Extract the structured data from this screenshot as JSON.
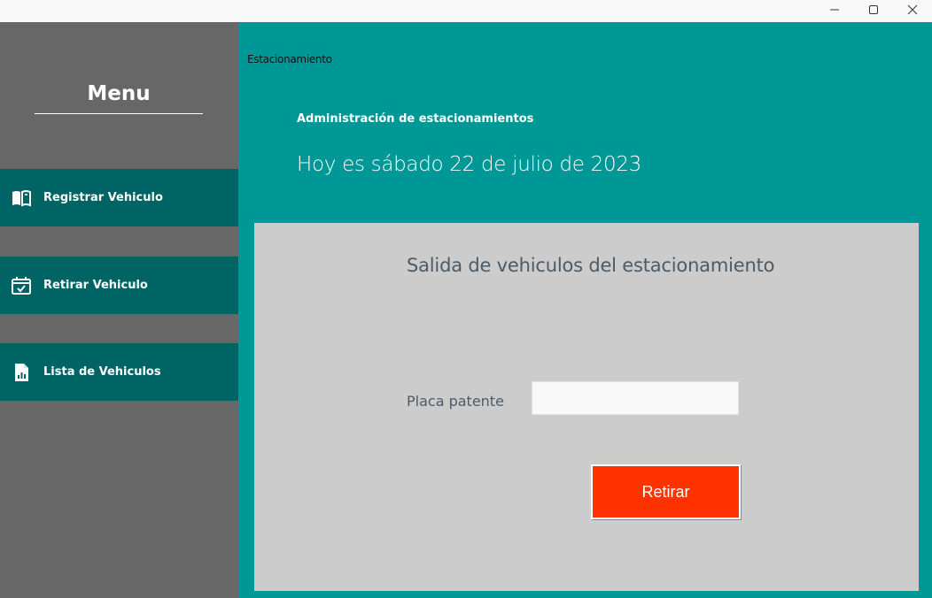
{
  "window": {
    "buttons": {
      "minimize": "minimize-icon",
      "maximize": "maximize-icon",
      "close": "close-icon"
    }
  },
  "sidebar": {
    "title": "Menu",
    "items": [
      {
        "label": "Registrar Vehiculo",
        "icon": "book-icon"
      },
      {
        "label": "Retirar Vehiculo",
        "icon": "calendar-check-icon"
      },
      {
        "label": "Lista de Vehiculos",
        "icon": "report-document-icon"
      }
    ]
  },
  "main": {
    "breadcrumb": "Estacionamiento",
    "heading": "Administración de estacionamientos",
    "date_text": "Hoy es sábado 22 de julio de 2023",
    "panel": {
      "title": "Salida de vehiculos del estacionamiento",
      "plate_label": "Placa patente",
      "plate_value": "",
      "submit_label": "Retirar"
    }
  },
  "colors": {
    "sidebar_bg": "#676767",
    "nav_item_bg": "#006464",
    "main_bg": "#009797",
    "panel_bg": "#cccccc",
    "accent_button": "#ff3300",
    "panel_text": "#4d5b66"
  }
}
